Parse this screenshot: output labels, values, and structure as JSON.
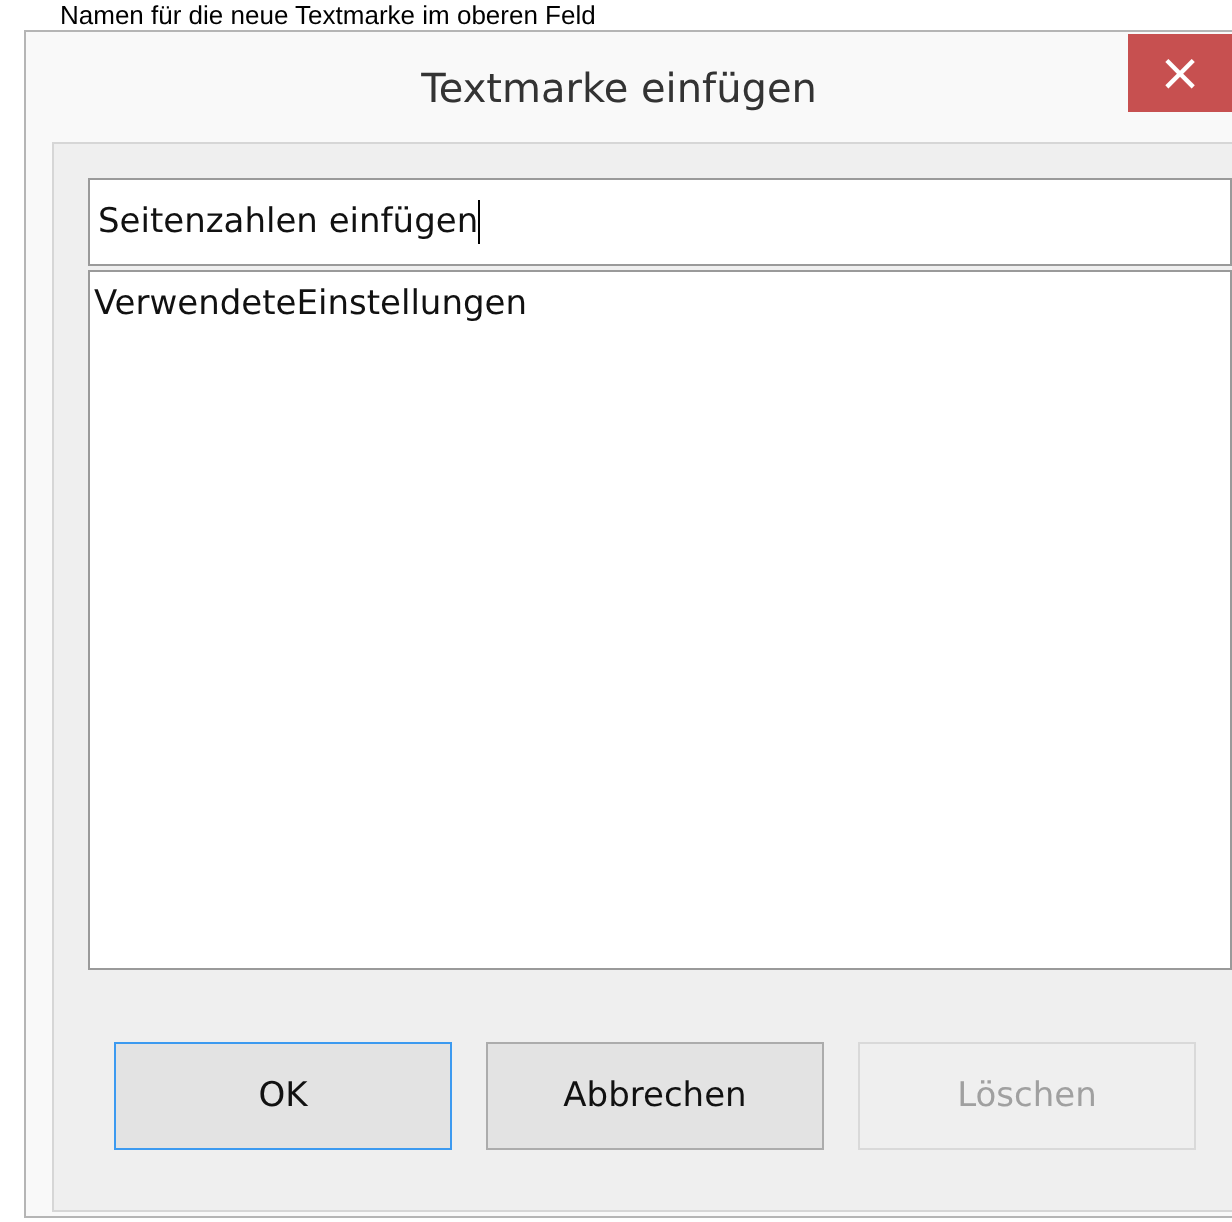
{
  "background_text": "Namen für die neue Textmarke im oberen Feld",
  "window": {
    "title": "Textmarke einfügen",
    "close_glyph": "×"
  },
  "name_field": {
    "value": "Seitenzahlen einfügen",
    "focused": true
  },
  "bookmark_list": {
    "items": [
      {
        "label": "VerwendeteEinstellungen",
        "selected": false
      }
    ]
  },
  "buttons": [
    {
      "label": "OK",
      "default": true,
      "disabled": false
    },
    {
      "label": "Abbrechen",
      "default": false,
      "disabled": false
    },
    {
      "label": "Löschen",
      "default": false,
      "disabled": true
    }
  ]
}
